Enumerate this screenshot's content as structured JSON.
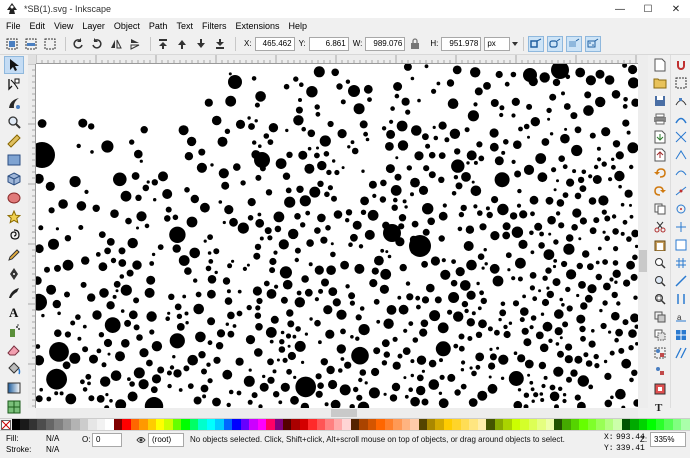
{
  "window": {
    "title": "*SB(1).svg - Inkscape",
    "minimize": "—",
    "maximize": "☐",
    "close": "✕"
  },
  "menu": [
    "File",
    "Edit",
    "View",
    "Layer",
    "Object",
    "Path",
    "Text",
    "Filters",
    "Extensions",
    "Help"
  ],
  "controls": {
    "x_label": "X:",
    "x_value": "465.462",
    "y_label": "Y:",
    "y_value": "6.861",
    "w_label": "W:",
    "w_value": "989.076",
    "h_label": "H:",
    "h_value": "951.978",
    "unit": "px"
  },
  "tools": [
    "selector-tool",
    "node-tool",
    "tweak-tool",
    "zoom-tool",
    "measure-tool",
    "rectangle-tool",
    "3dbox-tool",
    "ellipse-tool",
    "star-tool",
    "spiral-tool",
    "pencil-tool",
    "pen-tool",
    "calligraphy-tool",
    "text-tool",
    "spray-tool",
    "eraser-tool",
    "bucket-tool",
    "gradient-tool",
    "mesh-tool",
    "dropper-tool"
  ],
  "status": {
    "fill_label": "Fill:",
    "fill_value": "N/A",
    "stroke_label": "Stroke:",
    "stroke_value": "N/A",
    "opacity_label": "O:",
    "opacity_value": "0",
    "layer": "(root)",
    "message": "No objects selected. Click, Shift+click, Alt+scroll mouse on top of objects, or drag around objects to select.",
    "x_label": "X:",
    "x_value": "993.44",
    "y_label": "Y:",
    "y_value": "339.41",
    "zoom_label": "Z:",
    "zoom_value": "335%"
  },
  "palette_colors": [
    "#000000",
    "#1a1a1a",
    "#333333",
    "#4d4d4d",
    "#666666",
    "#808080",
    "#999999",
    "#b3b3b3",
    "#cccccc",
    "#e6e6e6",
    "#f2f2f2",
    "#ffffff",
    "#800000",
    "#ff0000",
    "#ff6600",
    "#ff9900",
    "#ffcc00",
    "#ffff00",
    "#ccff00",
    "#66ff00",
    "#00ff00",
    "#00ff66",
    "#00ffcc",
    "#00ffff",
    "#00ccff",
    "#0066ff",
    "#0000ff",
    "#6600ff",
    "#cc00ff",
    "#ff00ff",
    "#ff0066",
    "#800080",
    "#550000",
    "#aa0000",
    "#d40000",
    "#ff2a2a",
    "#ff5555",
    "#ff8080",
    "#ffaaaa",
    "#ffd5d5",
    "#552200",
    "#aa4400",
    "#d45500",
    "#ff6600",
    "#ff7f2a",
    "#ff9955",
    "#ffb380",
    "#ffccaa",
    "#554400",
    "#aa8800",
    "#d4aa00",
    "#ffcc00",
    "#ffd42a",
    "#ffdd55",
    "#ffe680",
    "#ffeeaa",
    "#445500",
    "#88aa00",
    "#aad400",
    "#ccff00",
    "#d4ff2a",
    "#ddff55",
    "#e5ff80",
    "#eeffaa",
    "#225500",
    "#44aa00",
    "#55d400",
    "#66ff00",
    "#7fff2a",
    "#99ff55",
    "#b3ff80",
    "#ccffaa",
    "#005500",
    "#00aa00",
    "#00d400",
    "#00ff00",
    "#2aff2a",
    "#55ff55",
    "#80ff80",
    "#aaffaa"
  ]
}
